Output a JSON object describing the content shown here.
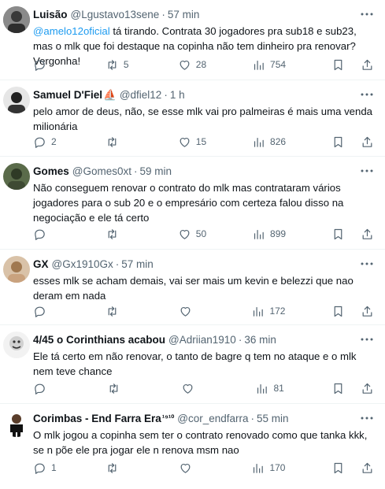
{
  "tweets": [
    {
      "name": "Luisão",
      "handle": "@Lgustavo13sene",
      "time": "57 min",
      "mention": "@amelo12oficial",
      "text": " tá tirando. Contrata 30 jogadores pra sub18 e sub23, mas o mlk que foi destaque na copinha não tem dinheiro pra renovar? Vergonha!",
      "replies": "",
      "retweets": "5",
      "likes": "28",
      "views": "754"
    },
    {
      "name": "Samuel D'Fiel",
      "name_suffix": "⛵",
      "handle": "@dfiel12",
      "time": "1 h",
      "text": "pelo amor de deus, não, se esse mlk vai pro palmeiras é mais uma venda milionária",
      "replies": "2",
      "retweets": "",
      "likes": "15",
      "views": "826"
    },
    {
      "name": "Gomes",
      "handle": "@Gomes0xt",
      "time": "59 min",
      "text": "Não conseguem renovar o contrato do mlk mas contrataram vários jogadores para o sub 20 e o empresário com certeza falou disso na negociação e ele tá certo",
      "replies": "",
      "retweets": "",
      "likes": "50",
      "views": "899"
    },
    {
      "name": "GX",
      "handle": "@Gx1910Gx",
      "time": "57 min",
      "text": "esses mlk se acham demais, vai ser mais um kevin e belezzi que nao deram em nada",
      "replies": "",
      "retweets": "",
      "likes": "",
      "views": "172"
    },
    {
      "name": "4/45 o Corinthians acabou",
      "handle": "@Adriian1910",
      "time": "36 min",
      "text": "Ele tá certo em não renovar, o tanto de bagre q tem no ataque e o mlk nem teve chance",
      "replies": "",
      "retweets": "",
      "likes": "",
      "views": "81"
    },
    {
      "name": "Corimbas - End Farra Era",
      "name_suffix": "¹⁹¹⁰",
      "handle": "@cor_endfarra",
      "time": "55 min",
      "text": "O mlk jogou a copinha sem ter o contrato renovado como que tanka kkk, se n põe ele pra jogar ele n renova msm nao",
      "replies": "1",
      "retweets": "",
      "likes": "",
      "views": "170"
    }
  ],
  "colors": {
    "accent": "#1d9bf0",
    "secondary_text": "#536471",
    "divider": "#eff3f4"
  }
}
